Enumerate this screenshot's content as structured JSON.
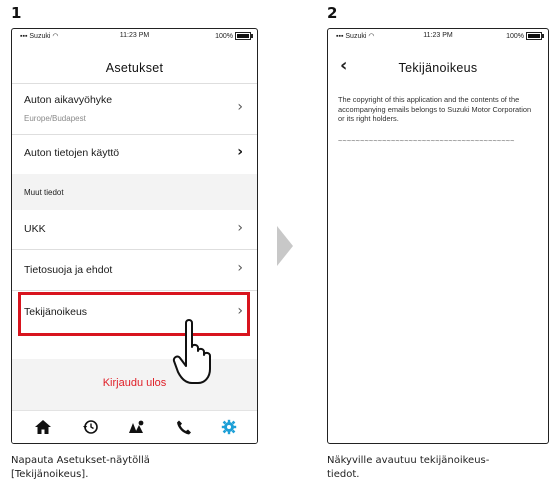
{
  "steps": [
    {
      "number": "1",
      "status": {
        "carrier": "Suzuki",
        "time": "11:23 PM",
        "battery": "100%"
      },
      "title": "Asetukset",
      "rows": [
        {
          "label": "Auton aikavyöhyke",
          "sub": "Europe/Budapest"
        },
        {
          "label": "Auton tietojen käyttö"
        }
      ],
      "section": "Muut tiedot",
      "rows2": [
        {
          "label": "UKK"
        },
        {
          "label": "Tietosuoja ja ehdot"
        },
        {
          "label": "Tekijänoikeus"
        }
      ],
      "logout": "Kirjaudu ulos",
      "tabs": [
        "home-icon",
        "history-icon",
        "map-icon",
        "phone-icon",
        "settings-gear-icon"
      ],
      "accent": "#1ea0d7",
      "caption_line1": "Napauta Asetukset-näytöllä",
      "caption_line2": "[Tekijänoikeus]."
    },
    {
      "number": "2",
      "status": {
        "carrier": "Suzuki",
        "time": "11:23 PM",
        "battery": "100%"
      },
      "title": "Tekijänoikeus",
      "body": "The copyright of this application and the contents of the accompanying emails belongs to Suzuki Motor Corporation or its right holders.",
      "tilde": "~~~~~~~~~~~~~~~~~~~~~~~~~~~~~~~~~~~~~~~~",
      "caption_line1": "Näkyville avautuu tekijänoikeus-",
      "caption_line2": "tiedot."
    }
  ],
  "colors": {
    "highlight": "#d8141e",
    "logout": "#e01e27",
    "arrow": "#c8c8c8"
  }
}
